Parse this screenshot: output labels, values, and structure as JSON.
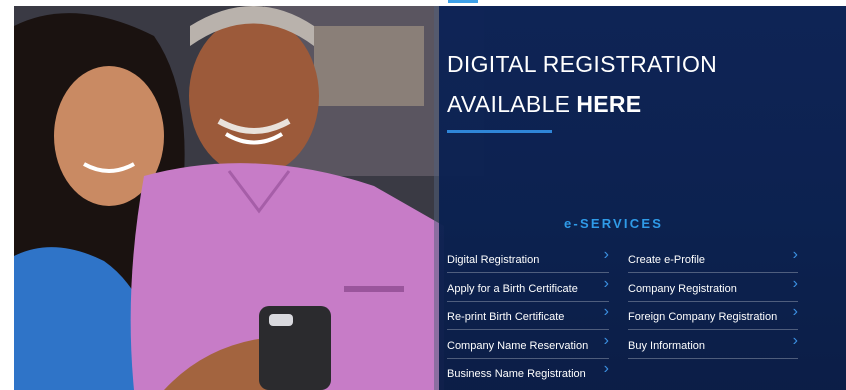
{
  "banner": {
    "headline_line1": "DIGITAL REGISTRATION",
    "headline_line2_light": "AVAILABLE",
    "headline_line2_bold": "HERE",
    "services_title": "e-SERVICES",
    "accent_color": "#2f86d8",
    "panel_color": "#0d2356"
  },
  "services": {
    "left": [
      {
        "label": "Digital Registration",
        "icon": "chevron-right-icon"
      },
      {
        "label": "Apply for a Birth Certificate",
        "icon": "chevron-right-icon"
      },
      {
        "label": "Re-print Birth Certificate",
        "icon": "chevron-right-icon"
      },
      {
        "label": "Company Name Reservation",
        "icon": "chevron-right-icon"
      },
      {
        "label": "Business Name Registration",
        "icon": "chevron-right-icon"
      }
    ],
    "right": [
      {
        "label": "Create e-Profile",
        "icon": "chevron-right-icon"
      },
      {
        "label": "Company Registration",
        "icon": "chevron-right-icon"
      },
      {
        "label": "Foreign Company Registration",
        "icon": "chevron-right-icon"
      },
      {
        "label": "Buy Information",
        "icon": "chevron-right-icon"
      }
    ]
  }
}
